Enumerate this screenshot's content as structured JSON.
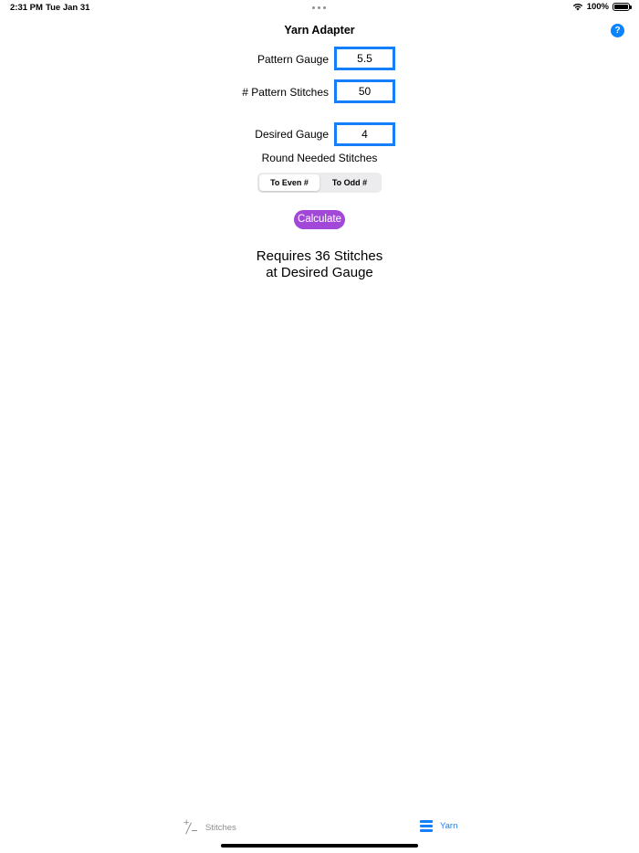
{
  "status_bar": {
    "time": "2:31 PM",
    "date": "Tue Jan 31",
    "battery": "100%"
  },
  "nav": {
    "title": "Yarn Adapter",
    "help_label": "?"
  },
  "form": {
    "pattern_gauge_label": "Pattern Gauge",
    "pattern_gauge_value": "5.5",
    "pattern_stitches_label": "# Pattern Stitches",
    "pattern_stitches_value": "50",
    "desired_gauge_label": "Desired Gauge",
    "desired_gauge_value": "4",
    "round_label": "Round Needed Stitches",
    "round_options": [
      "To Even #",
      "To Odd #"
    ],
    "round_selected": "To Even #",
    "calculate_label": "Calculate"
  },
  "result": {
    "line1": "Requires 36 Stitches",
    "line2": "at Desired Gauge"
  },
  "tab_bar": {
    "tabs": [
      {
        "label": "Stitches",
        "icon": "plus-minus-icon",
        "selected": false
      },
      {
        "label": "Yarn",
        "icon": "list-icon",
        "selected": true
      }
    ]
  },
  "colors": {
    "accent": "#147efb",
    "button": "#a248d8",
    "inactive": "#8e8e93"
  }
}
